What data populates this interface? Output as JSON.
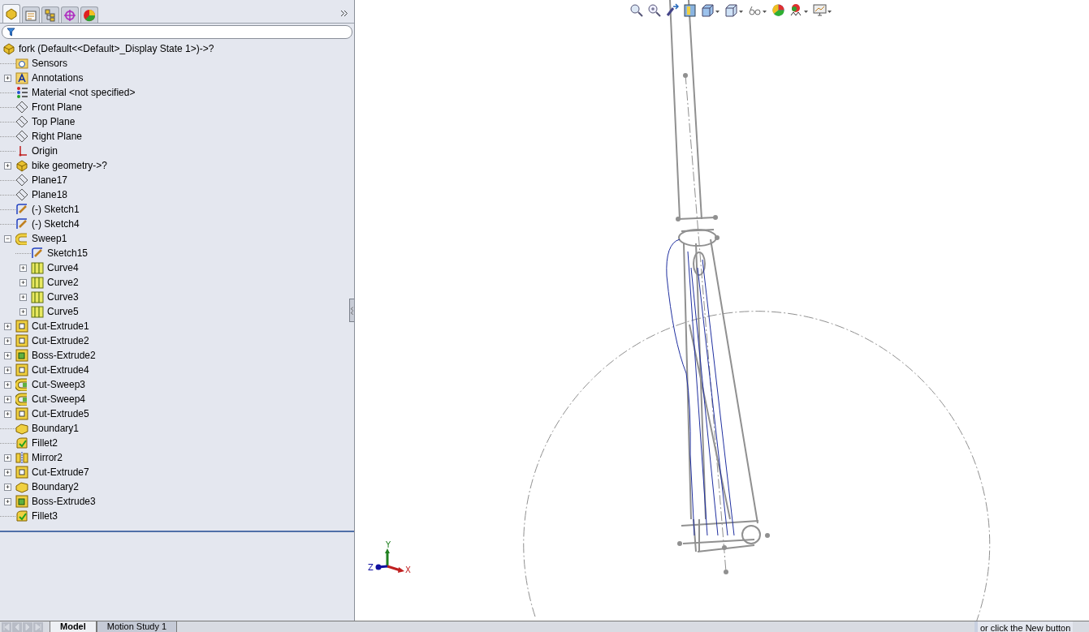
{
  "panel_tabs": [
    {
      "kind": "feature-manager",
      "selected": true
    },
    {
      "kind": "property-manager",
      "selected": false
    },
    {
      "kind": "configuration-manager",
      "selected": false
    },
    {
      "kind": "dimxpert",
      "selected": false
    },
    {
      "kind": "display-manager",
      "selected": false
    }
  ],
  "tree": {
    "root": {
      "label": "fork  (Default<<Default>_Display State 1>)->?",
      "kind": "part"
    },
    "items": [
      {
        "label": "Sensors",
        "kind": "sensors"
      },
      {
        "label": "Annotations",
        "kind": "annotations",
        "expanded": false
      },
      {
        "label": "Material <not specified>",
        "kind": "material"
      },
      {
        "label": "Front Plane",
        "kind": "plane"
      },
      {
        "label": "Top Plane",
        "kind": "plane"
      },
      {
        "label": "Right Plane",
        "kind": "plane"
      },
      {
        "label": "Origin",
        "kind": "origin"
      },
      {
        "label": "bike geometry->?",
        "kind": "part",
        "expanded": false
      },
      {
        "label": "Plane17",
        "kind": "plane"
      },
      {
        "label": "Plane18",
        "kind": "plane"
      },
      {
        "label": "(-) Sketch1",
        "kind": "sketch"
      },
      {
        "label": "(-) Sketch4",
        "kind": "sketch"
      },
      {
        "label": "Sweep1",
        "kind": "sweep",
        "expanded": true,
        "children": [
          {
            "label": "Sketch15",
            "kind": "sketch"
          },
          {
            "label": "Curve4",
            "kind": "curve",
            "expanded": false
          },
          {
            "label": "Curve2",
            "kind": "curve",
            "expanded": false
          },
          {
            "label": "Curve3",
            "kind": "curve",
            "expanded": false
          },
          {
            "label": "Curve5",
            "kind": "curve",
            "expanded": false
          }
        ]
      },
      {
        "label": "Cut-Extrude1",
        "kind": "cut-extrude",
        "expanded": false
      },
      {
        "label": "Cut-Extrude2",
        "kind": "cut-extrude",
        "expanded": false
      },
      {
        "label": "Boss-Extrude2",
        "kind": "boss-extrude",
        "expanded": false
      },
      {
        "label": "Cut-Extrude4",
        "kind": "cut-extrude",
        "expanded": false
      },
      {
        "label": "Cut-Sweep3",
        "kind": "cut-sweep",
        "expanded": false
      },
      {
        "label": "Cut-Sweep4",
        "kind": "cut-sweep",
        "expanded": false
      },
      {
        "label": "Cut-Extrude5",
        "kind": "cut-extrude",
        "expanded": false
      },
      {
        "label": "Boundary1",
        "kind": "boundary"
      },
      {
        "label": "Fillet2",
        "kind": "fillet"
      },
      {
        "label": "Mirror2",
        "kind": "mirror",
        "expanded": false
      },
      {
        "label": "Cut-Extrude7",
        "kind": "cut-extrude",
        "expanded": false
      },
      {
        "label": "Boundary2",
        "kind": "boundary",
        "expanded": false
      },
      {
        "label": "Boss-Extrude3",
        "kind": "boss-extrude",
        "expanded": false
      },
      {
        "label": "Fillet3",
        "kind": "fillet"
      }
    ]
  },
  "triad": {
    "x": "X",
    "y": "Y",
    "z": "Z"
  },
  "bottom_tabs": [
    {
      "label": "Model",
      "selected": true
    },
    {
      "label": "Motion Study 1",
      "selected": false
    }
  ],
  "tooltip": {
    "text": "or click the New button"
  }
}
